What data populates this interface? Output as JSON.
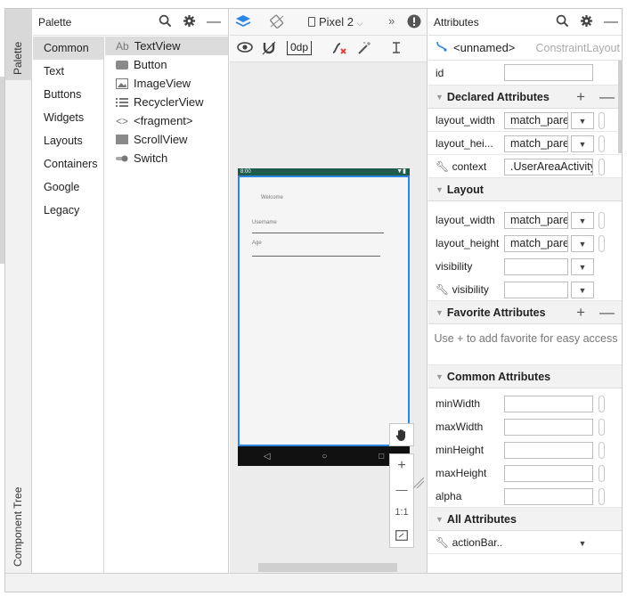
{
  "sidebar": {
    "palette_tab": "Palette",
    "component_tree_tab": "Component Tree"
  },
  "palette": {
    "title": "Palette",
    "categories": [
      "Common",
      "Text",
      "Buttons",
      "Widgets",
      "Layouts",
      "Containers",
      "Google",
      "Legacy"
    ],
    "selected_category": "Common",
    "widgets": [
      {
        "prefix": "Ab",
        "label": "TextView",
        "icon": "textview-icon"
      },
      {
        "prefix": "",
        "label": "Button",
        "icon": "button-icon"
      },
      {
        "prefix": "",
        "label": "ImageView",
        "icon": "image-icon"
      },
      {
        "prefix": "",
        "label": "RecyclerView",
        "icon": "list-icon"
      },
      {
        "prefix": "<>",
        "label": "<fragment>",
        "icon": "fragment-icon"
      },
      {
        "prefix": "",
        "label": "ScrollView",
        "icon": "scrollview-icon"
      },
      {
        "prefix": "",
        "label": "Switch",
        "icon": "switch-icon"
      }
    ]
  },
  "design_toolbar": {
    "device": "Pixel 2",
    "default_margin": "0dp"
  },
  "phone_preview": {
    "time": "8:00",
    "welcome_text": "Welcome",
    "username_hint": "Username",
    "age_hint": "Age",
    "nav_back": "◁",
    "nav_home": "○",
    "nav_recent": "□"
  },
  "zoom": {
    "reset_label": "1:1",
    "zoom_in": "+",
    "zoom_out": "—"
  },
  "attributes": {
    "title": "Attributes",
    "component_name": "<unnamed>",
    "component_type": "ConstraintLayout",
    "id_label": "id",
    "id_value": "",
    "sections": {
      "declared": "Declared Attributes",
      "layout": "Layout",
      "favorite": "Favorite Attributes",
      "common": "Common Attributes",
      "all": "All Attributes"
    },
    "declared_rows": [
      {
        "label": "layout_width",
        "value": "match_pare"
      },
      {
        "label": "layout_hei...",
        "value": "match_pare"
      },
      {
        "label": "context",
        "value": ".UserAreaActivity"
      }
    ],
    "layout_rows": [
      {
        "label": "layout_width",
        "value": "match_pare"
      },
      {
        "label": "layout_height",
        "value": "match_pare"
      },
      {
        "label": "visibility",
        "value": ""
      },
      {
        "label": "visibility",
        "value": ""
      }
    ],
    "favorite_message": "Use + to add favorite for easy access",
    "common_rows": [
      {
        "label": "minWidth",
        "value": ""
      },
      {
        "label": "maxWidth",
        "value": ""
      },
      {
        "label": "minHeight",
        "value": ""
      },
      {
        "label": "maxHeight",
        "value": ""
      },
      {
        "label": "alpha",
        "value": ""
      }
    ],
    "all_rows": [
      {
        "label": "actionBar...",
        "value": ""
      }
    ]
  },
  "colors": {
    "accent_blue": "#2d86e0",
    "statusbar": "#1f5c4c",
    "error_red": "#e0443b",
    "selection_gray": "#dcdcdc"
  }
}
